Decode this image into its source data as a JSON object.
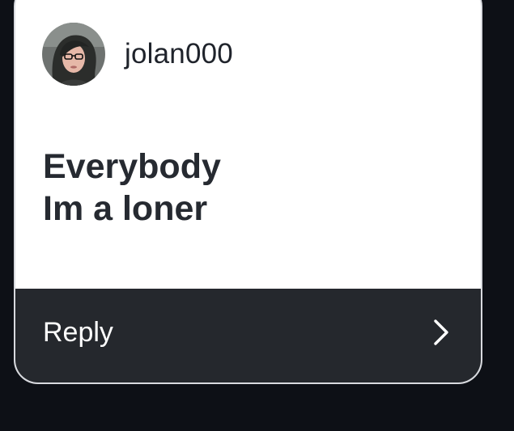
{
  "post": {
    "username": "jolan000",
    "avatar": "user-avatar-photo",
    "message_lines": [
      "Everybody",
      "Im a loner"
    ]
  },
  "footer": {
    "reply_label": "Reply",
    "icon": "chevron-right-icon"
  },
  "colors": {
    "page_background": "#0d1016",
    "card_background": "#ffffff",
    "footer_background": "#25282d",
    "text_dark": "#262a31",
    "text_light": "#ffffff"
  }
}
